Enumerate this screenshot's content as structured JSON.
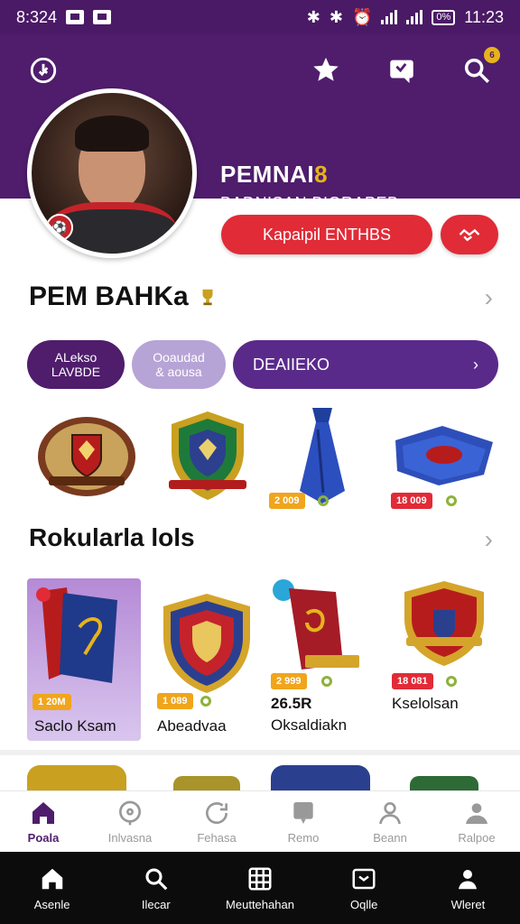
{
  "status": {
    "time_left": "8:324",
    "time_right": "11:23",
    "battery": "0%"
  },
  "header": {
    "profile_name": "PEMNAI",
    "profile_name_badge": "8",
    "profile_subtitle": "BADNISAN BIGRAPEB",
    "primary_button": "Kapaipil ENTHBS",
    "search_badge": "6"
  },
  "section1": {
    "title": "PEM BAHKa",
    "pills": [
      {
        "line1": "ALekso",
        "line2": "LAVBDE"
      },
      {
        "line1": "Ooaudad",
        "line2": "& aousa"
      },
      {
        "line1": "DEAIIEKO"
      }
    ],
    "items": [
      {
        "name": "shield-badge-red"
      },
      {
        "name": "shield-badge-green"
      },
      {
        "name": "blue-tie",
        "price": "2 009"
      },
      {
        "name": "blue-scarf",
        "price": "18 009"
      }
    ]
  },
  "section2": {
    "title": "Rokularla lols",
    "items": [
      {
        "price": "1 20M",
        "label": "Saclo Ksam"
      },
      {
        "price": "1 089",
        "label": "Abeadvaa"
      },
      {
        "price": "2 999",
        "label": "Oksaldiakn",
        "value": "26.5R"
      },
      {
        "price": "18 081",
        "label": "Kselolsan"
      }
    ]
  },
  "bottom_tabs": [
    {
      "label": "Poala",
      "icon": "home-icon",
      "active": true
    },
    {
      "label": "Inlvasna",
      "icon": "compass-icon"
    },
    {
      "label": "Fehasa",
      "icon": "refresh-icon"
    },
    {
      "label": "Remo",
      "icon": "message-icon"
    },
    {
      "label": "Beann",
      "icon": "person-icon"
    },
    {
      "label": "Ralpoe",
      "icon": "account-icon"
    }
  ],
  "system_nav": [
    {
      "label": "Asenle",
      "icon": "home-icon"
    },
    {
      "label": "Ilecar",
      "icon": "search-icon"
    },
    {
      "label": "Meuttehahan",
      "icon": "grid-icon"
    },
    {
      "label": "Oqlle",
      "icon": "box-icon"
    },
    {
      "label": "Wleret",
      "icon": "user-icon"
    }
  ],
  "colors": {
    "brand_purple": "#4f1d6c",
    "accent_red": "#e12b37",
    "gold": "#e6b31c",
    "price_orange": "#f0a51c"
  }
}
